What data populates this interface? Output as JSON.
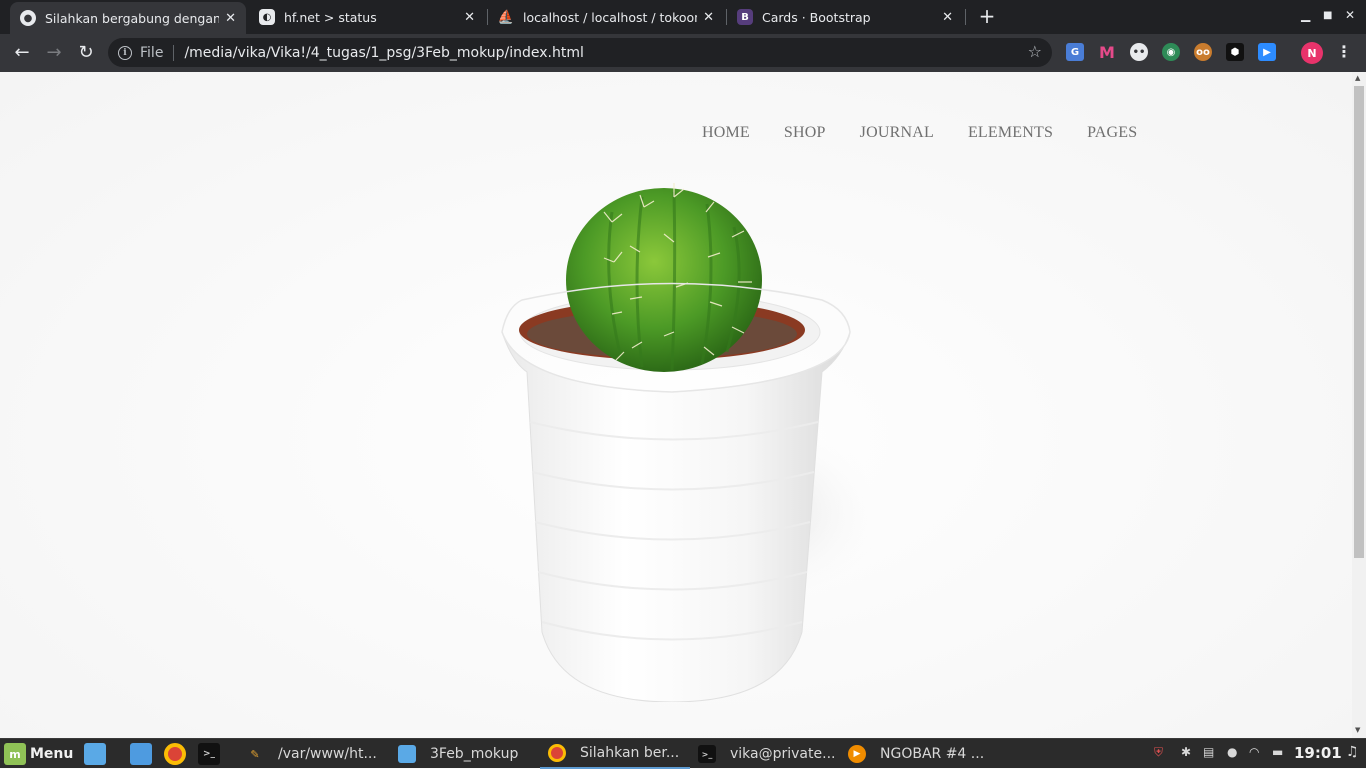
{
  "browser": {
    "tabs": [
      {
        "label": "Silahkan bergabung dengan ka",
        "active": true
      },
      {
        "label": "hf.net > status",
        "active": false
      },
      {
        "label": "localhost / localhost / tokoonline",
        "active": false
      },
      {
        "label": "Cards · Bootstrap",
        "active": false
      }
    ],
    "omnibox": {
      "scheme": "File",
      "url": "/media/vika/Vika!/4_tugas/1_psg/3Feb_mokup/index.html"
    },
    "profile_initial": "N"
  },
  "page": {
    "nav": [
      "HOME",
      "SHOP",
      "JOURNAL",
      "ELEMENTS",
      "PAGES"
    ]
  },
  "taskbar": {
    "menu_label": "Menu",
    "windows": [
      {
        "label": "/var/www/ht..."
      },
      {
        "label": "3Feb_mokup"
      },
      {
        "label": "Silahkan ber..."
      },
      {
        "label": "vika@private..."
      },
      {
        "label": "NGOBAR #4 ..."
      }
    ],
    "clock": "19:01"
  },
  "colors": {
    "chrome_dark": "#202124",
    "chrome_mid": "#35363a",
    "nav_text": "#707070",
    "taskbar": "#2b2b2b",
    "profile": "#e8336b"
  }
}
